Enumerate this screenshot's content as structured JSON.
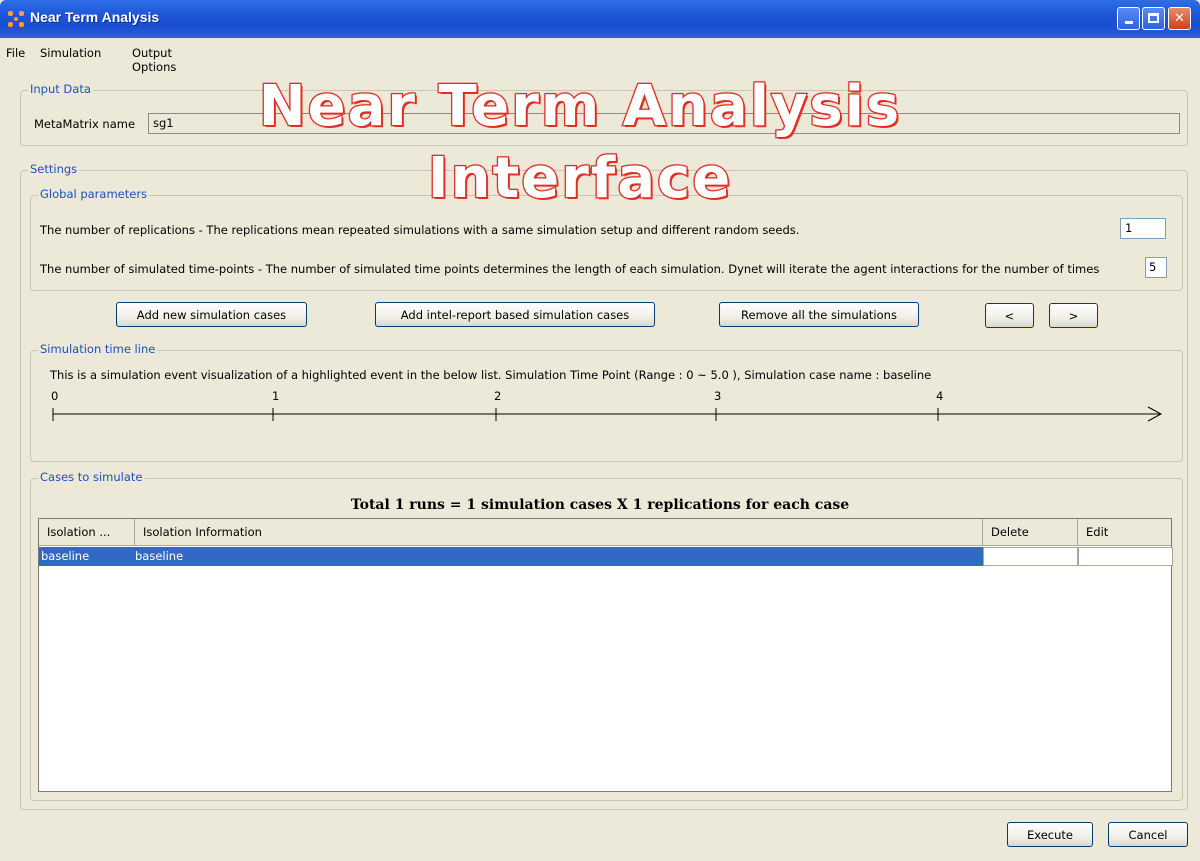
{
  "window": {
    "title": "Near Term Analysis"
  },
  "menu": [
    "File",
    "Simulation",
    "Output Options"
  ],
  "overlay": {
    "line1": "Near Term Analysis",
    "line2": "Interface"
  },
  "input_data": {
    "group_title": "Input Data",
    "metamatrix_label": "MetaMatrix name",
    "metamatrix_value": "sg1"
  },
  "settings": {
    "group_title": "Settings",
    "global_title": "Global parameters",
    "replications_label": "The number of replications - The replications mean repeated simulations with a same simulation setup and different random seeds.",
    "replications_value": "1",
    "timepoints_label": "The number of simulated time-points - The number of simulated time points determines the length of each simulation. Dynet will iterate the agent interactions for the number of times",
    "timepoints_value": "5"
  },
  "buttons": {
    "add_new": "Add new simulation cases",
    "add_intel": "Add intel-report based simulation cases",
    "remove_all": "Remove all the simulations",
    "prev": "<",
    "next": ">",
    "execute": "Execute",
    "cancel": "Cancel"
  },
  "timeline": {
    "group_title": "Simulation time line",
    "description": "This is a simulation event visualization of a highlighted event in the below list. Simulation Time Point (Range : 0 ~ 5.0 ), Simulation case name : baseline",
    "ticks": [
      "0",
      "1",
      "2",
      "3",
      "4"
    ]
  },
  "cases": {
    "group_title": "Cases to simulate",
    "summary": "Total 1 runs = 1 simulation cases X 1 replications for each case",
    "columns": [
      "Isolation ...",
      "Isolation Information",
      "Delete",
      "Edit"
    ],
    "rows": [
      {
        "name": "baseline",
        "info": "baseline"
      }
    ]
  },
  "colors": {
    "titlebar": "#1d56d7",
    "group_title": "#1e4fbf",
    "selection": "#316ac5",
    "overlay_outline": "#e8332a"
  }
}
